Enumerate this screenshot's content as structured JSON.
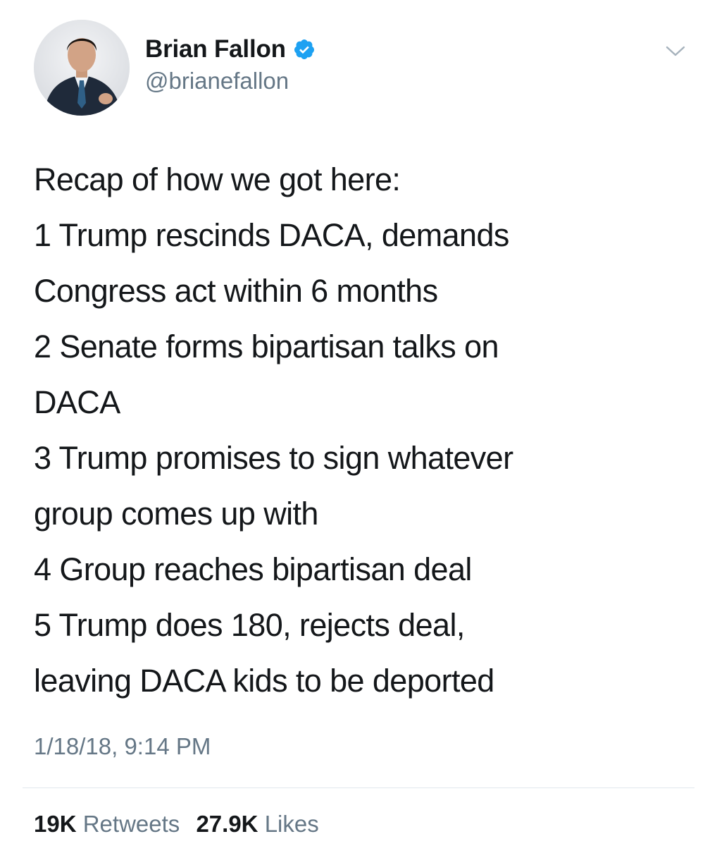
{
  "author": {
    "display_name": "Brian Fallon",
    "handle": "@brianefallon",
    "verified": true,
    "verified_color": "#1da1f2"
  },
  "tweet": {
    "lines": [
      "Recap of how we got here:",
      "1 Trump rescinds DACA, demands",
      "Congress act within 6 months",
      "2 Senate forms bipartisan talks on",
      "DACA",
      "3 Trump promises to sign whatever",
      "group comes up with",
      "4 Group reaches bipartisan deal",
      "5 Trump does 180, rejects deal,",
      "leaving DACA kids to be deported"
    ],
    "timestamp": "1/18/18, 9:14 PM"
  },
  "stats": {
    "retweets_count": "19K",
    "retweets_label": "Retweets",
    "likes_count": "27.9K",
    "likes_label": "Likes"
  },
  "icons": {
    "verified": "verified-badge-icon",
    "menu": "chevron-down-icon"
  },
  "colors": {
    "text": "#14171a",
    "secondary": "#657786",
    "divider": "#e1e8ed"
  }
}
